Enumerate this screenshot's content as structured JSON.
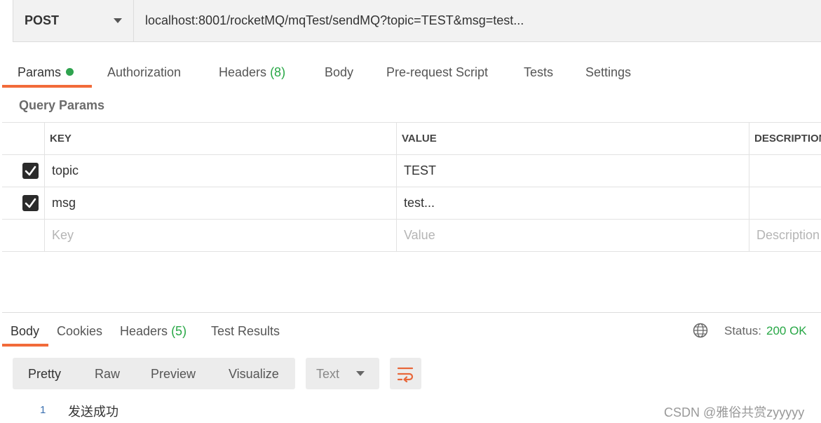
{
  "request": {
    "method": "POST",
    "url": "localhost:8001/rocketMQ/mqTest/sendMQ?topic=TEST&msg=test..."
  },
  "request_tabs": {
    "params": "Params",
    "authorization": "Authorization",
    "headers": "Headers",
    "headers_count": "(8)",
    "body": "Body",
    "prerequest": "Pre-request Script",
    "tests": "Tests",
    "settings": "Settings"
  },
  "query_params": {
    "title": "Query Params",
    "columns": {
      "key": "KEY",
      "value": "VALUE",
      "description": "DESCRIPTION"
    },
    "rows": [
      {
        "checked": true,
        "key": "topic",
        "value": "TEST",
        "description": ""
      },
      {
        "checked": true,
        "key": "msg",
        "value": "test...",
        "description": ""
      }
    ],
    "placeholder": {
      "key": "Key",
      "value": "Value",
      "description": "Description"
    }
  },
  "response_tabs": {
    "body": "Body",
    "cookies": "Cookies",
    "headers": "Headers",
    "headers_count": "(5)",
    "test_results": "Test Results"
  },
  "response_status": {
    "label": "Status:",
    "value": "200 OK"
  },
  "response_view": {
    "modes": {
      "pretty": "Pretty",
      "raw": "Raw",
      "preview": "Preview",
      "visualize": "Visualize"
    },
    "format": "Text"
  },
  "response_body": {
    "line_number": "1",
    "text": "发送成功"
  },
  "watermark": "CSDN @雅俗共赏zyyyyy",
  "colors": {
    "accent": "#f26b3a",
    "success": "#27a745",
    "checkbox": "#2b2b2b"
  },
  "icons": [
    "chevron-down-icon",
    "check-icon",
    "globe-icon",
    "wrap-lines-icon"
  ]
}
